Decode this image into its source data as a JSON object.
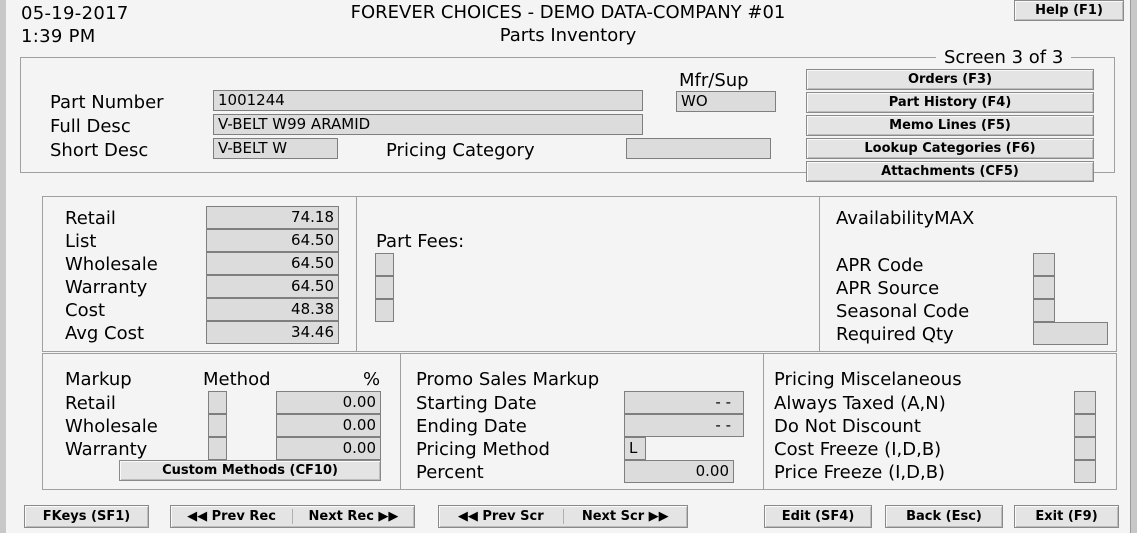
{
  "header": {
    "date": "05-19-2017",
    "time": "1:39 PM",
    "company": "FOREVER CHOICES - DEMO DATA-COMPANY #01",
    "screen_title": "Parts Inventory",
    "help_button": "Help (F1)",
    "screen_indicator": "Screen 3 of 3"
  },
  "identity": {
    "part_number_label": "Part Number",
    "part_number_value": "1001244",
    "full_desc_label": "Full Desc",
    "full_desc_value": "V-BELT W99 ARAMID",
    "short_desc_label": "Short Desc",
    "short_desc_value": "V-BELT W",
    "pricing_category_label": "Pricing Category",
    "pricing_category_value": "",
    "mfr_sup_label": "Mfr/Sup",
    "mfr_sup_value": "WO"
  },
  "actions": [
    {
      "label": "Orders (F3)"
    },
    {
      "label": "Part History (F4)"
    },
    {
      "label": "Memo Lines (F5)"
    },
    {
      "label": "Lookup Categories (F6)"
    },
    {
      "label": "Attachments (CF5)"
    }
  ],
  "prices": {
    "rows": [
      {
        "label": "Retail",
        "value": "74.18"
      },
      {
        "label": "List",
        "value": "64.50"
      },
      {
        "label": "Wholesale",
        "value": "64.50"
      },
      {
        "label": "Warranty",
        "value": "64.50"
      },
      {
        "label": "Cost",
        "value": "48.38"
      },
      {
        "label": "Avg Cost",
        "value": "34.46"
      }
    ]
  },
  "part_fees": {
    "label": "Part Fees:",
    "values": [
      "",
      "",
      ""
    ]
  },
  "availability": {
    "title": "AvailabilityMAX",
    "rows": [
      {
        "label": "APR Code",
        "value": ""
      },
      {
        "label": "APR Source",
        "value": ""
      },
      {
        "label": "Seasonal Code",
        "value": ""
      },
      {
        "label": "Required Qty",
        "value": ""
      }
    ]
  },
  "markup": {
    "title": "Markup",
    "method_header": "Method",
    "percent_header": "%",
    "rows": [
      {
        "label": "Retail",
        "method": "",
        "percent": "0.00"
      },
      {
        "label": "Wholesale",
        "method": "",
        "percent": "0.00"
      },
      {
        "label": "Warranty",
        "method": "",
        "percent": "0.00"
      }
    ],
    "custom_methods_button": "Custom Methods (CF10)"
  },
  "promo": {
    "title": "Promo Sales Markup",
    "rows": [
      {
        "label": "Starting Date",
        "value": "-  -"
      },
      {
        "label": "Ending Date",
        "value": "-  -"
      },
      {
        "label": "Pricing Method",
        "value": "L"
      },
      {
        "label": "Percent",
        "value": "0.00"
      }
    ]
  },
  "misc": {
    "title": "Pricing Miscelaneous",
    "rows": [
      {
        "label": "Always Taxed (A,N)",
        "value": ""
      },
      {
        "label": "Do Not Discount",
        "value": ""
      },
      {
        "label": "Cost Freeze (I,D,B)",
        "value": ""
      },
      {
        "label": "Price Freeze (I,D,B)",
        "value": ""
      }
    ]
  },
  "footer": {
    "fkeys": "FKeys (SF1)",
    "prev_rec": "◀◀ Prev Rec",
    "next_rec": "Next Rec ▶▶",
    "prev_scr": "◀◀ Prev Scr",
    "next_scr": "Next Scr ▶▶",
    "edit": "Edit (SF4)",
    "back": "Back (Esc)",
    "exit": "Exit (F9)"
  },
  "colors": {
    "background": "#f4f4f4",
    "field_fill": "#dcdcdc",
    "button_face": "#e4e4e4",
    "border": "#8a8a8a"
  }
}
